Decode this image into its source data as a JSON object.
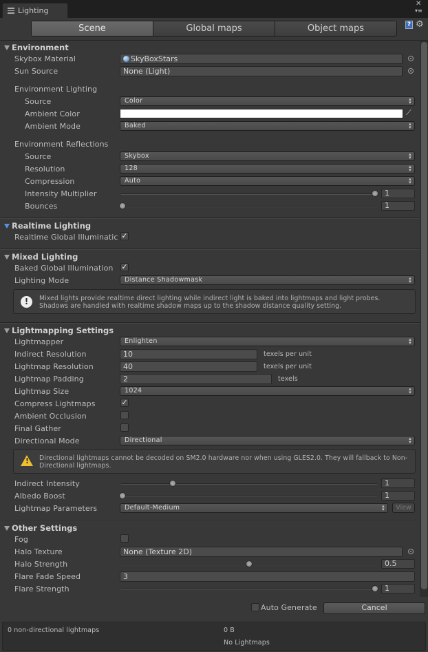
{
  "window": {
    "tab_title": "Lighting"
  },
  "toolbar": {
    "tabs": [
      "Scene",
      "Global maps",
      "Object maps"
    ],
    "active_tab": "Scene"
  },
  "environment": {
    "title": "Environment",
    "skybox_material": {
      "label": "Skybox Material",
      "value": "SkyBoxStars"
    },
    "sun_source": {
      "label": "Sun Source",
      "value": "None (Light)"
    },
    "env_lighting": {
      "title": "Environment Lighting",
      "source": {
        "label": "Source",
        "value": "Color"
      },
      "ambient_color": {
        "label": "Ambient Color",
        "color": "#ffffff"
      },
      "ambient_mode": {
        "label": "Ambient Mode",
        "value": "Baked"
      }
    },
    "env_reflections": {
      "title": "Environment Reflections",
      "source": {
        "label": "Source",
        "value": "Skybox"
      },
      "resolution": {
        "label": "Resolution",
        "value": "128"
      },
      "compression": {
        "label": "Compression",
        "value": "Auto"
      },
      "intensity": {
        "label": "Intensity Multiplier",
        "value": "1",
        "fraction": 1.0
      },
      "bounces": {
        "label": "Bounces",
        "value": "1",
        "fraction": 0.0
      }
    }
  },
  "realtime": {
    "title": "Realtime Lighting",
    "gi": {
      "label": "Realtime Global Illuminatic",
      "checked": true
    }
  },
  "mixed": {
    "title": "Mixed Lighting",
    "baked_gi": {
      "label": "Baked Global Illumination",
      "checked": true
    },
    "lighting_mode": {
      "label": "Lighting Mode",
      "value": "Distance Shadowmask"
    },
    "info": "Mixed lights provide realtime direct lighting while indirect light is baked into lightmaps and light probes. Shadows are handled with realtime shadow maps up to the shadow distance quality setting."
  },
  "lightmapping": {
    "title": "Lightmapping Settings",
    "lightmapper": {
      "label": "Lightmapper",
      "value": "Enlighten"
    },
    "indirect_resolution": {
      "label": "Indirect Resolution",
      "value": "10",
      "unit": "texels per unit"
    },
    "lightmap_resolution": {
      "label": "Lightmap Resolution",
      "value": "40",
      "unit": "texels per unit"
    },
    "lightmap_padding": {
      "label": "Lightmap Padding",
      "value": "2",
      "unit": "texels"
    },
    "lightmap_size": {
      "label": "Lightmap Size",
      "value": "1024"
    },
    "compress": {
      "label": "Compress Lightmaps",
      "checked": true
    },
    "ao": {
      "label": "Ambient Occlusion",
      "checked": false
    },
    "final_gather": {
      "label": "Final Gather",
      "checked": false
    },
    "directional_mode": {
      "label": "Directional Mode",
      "value": "Directional"
    },
    "warning": "Directional lightmaps cannot be decoded on SM2.0 hardware nor when using GLES2.0. They will fallback to Non-Directional lightmaps.",
    "indirect_intensity": {
      "label": "Indirect Intensity",
      "value": "1",
      "fraction": 0.2
    },
    "albedo_boost": {
      "label": "Albedo Boost",
      "value": "1",
      "fraction": 0.0
    },
    "lightmap_params": {
      "label": "Lightmap Parameters",
      "value": "Default-Medium",
      "view_label": "View"
    }
  },
  "other": {
    "title": "Other Settings",
    "fog": {
      "label": "Fog",
      "checked": false
    },
    "halo_texture": {
      "label": "Halo Texture",
      "value": "None (Texture 2D)"
    },
    "halo_strength": {
      "label": "Halo Strength",
      "value": "0.5",
      "fraction": 0.5
    },
    "flare_fade": {
      "label": "Flare Fade Speed",
      "value": "3"
    },
    "flare_strength": {
      "label": "Flare Strength",
      "value": "1",
      "fraction": 1.0
    }
  },
  "footer": {
    "auto_generate": {
      "label": "Auto Generate",
      "checked": false
    },
    "cancel_label": "Cancel",
    "lightmap_count": "0 non-directional lightmaps",
    "size": "0 B",
    "status": "No Lightmaps"
  }
}
